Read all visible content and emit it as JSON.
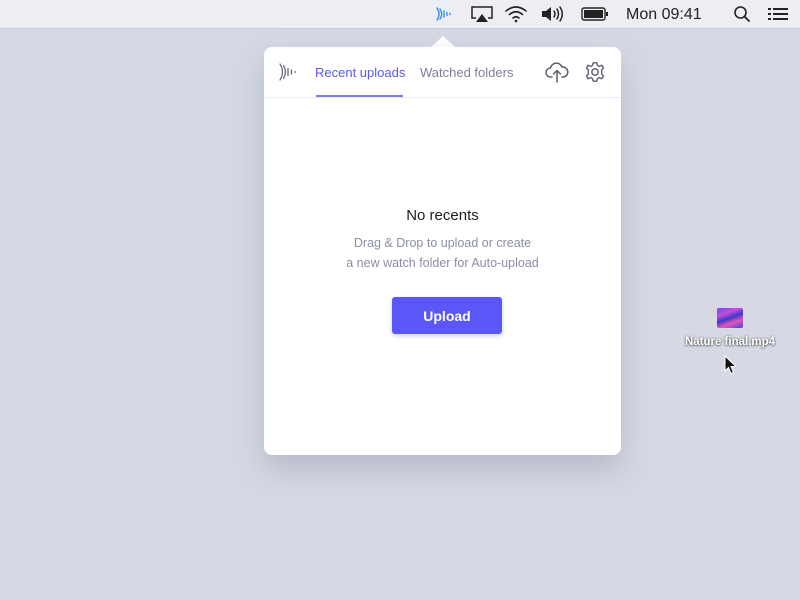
{
  "menubar": {
    "icons": [
      "app-waveform-icon",
      "airplay-icon",
      "wifi-icon",
      "volume-icon",
      "battery-icon",
      "spotlight-search-icon",
      "notification-center-icon"
    ],
    "clock": "Mon 09:41",
    "accent": "#3b8cf5"
  },
  "popover": {
    "tabs": [
      {
        "label": "Recent uploads",
        "active": true
      },
      {
        "label": "Watched folders",
        "active": false
      }
    ],
    "empty_state": {
      "title": "No recents",
      "line1": "Drag & Drop to upload or create",
      "line2": "a new watch folder for Auto-upload"
    },
    "upload_label": "Upload",
    "accent": "#5b56f7"
  },
  "desktop": {
    "file_name": "Nature final.mp4"
  }
}
